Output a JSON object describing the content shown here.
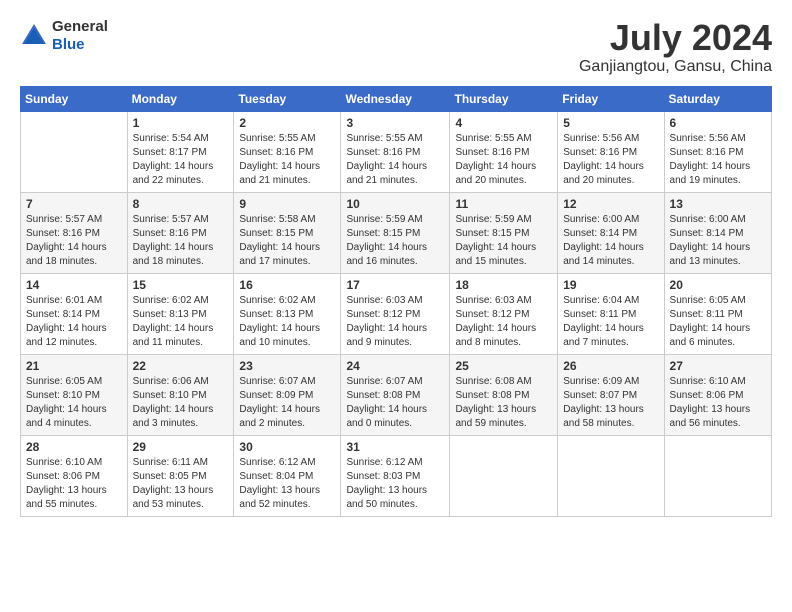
{
  "header": {
    "logo": {
      "line1": "General",
      "line2": "Blue"
    },
    "title": "July 2024",
    "location": "Ganjiangtou, Gansu, China"
  },
  "days_of_week": [
    "Sunday",
    "Monday",
    "Tuesday",
    "Wednesday",
    "Thursday",
    "Friday",
    "Saturday"
  ],
  "weeks": [
    [
      {
        "day": "",
        "info": ""
      },
      {
        "day": "1",
        "info": "Sunrise: 5:54 AM\nSunset: 8:17 PM\nDaylight: 14 hours\nand 22 minutes."
      },
      {
        "day": "2",
        "info": "Sunrise: 5:55 AM\nSunset: 8:16 PM\nDaylight: 14 hours\nand 21 minutes."
      },
      {
        "day": "3",
        "info": "Sunrise: 5:55 AM\nSunset: 8:16 PM\nDaylight: 14 hours\nand 21 minutes."
      },
      {
        "day": "4",
        "info": "Sunrise: 5:55 AM\nSunset: 8:16 PM\nDaylight: 14 hours\nand 20 minutes."
      },
      {
        "day": "5",
        "info": "Sunrise: 5:56 AM\nSunset: 8:16 PM\nDaylight: 14 hours\nand 20 minutes."
      },
      {
        "day": "6",
        "info": "Sunrise: 5:56 AM\nSunset: 8:16 PM\nDaylight: 14 hours\nand 19 minutes."
      }
    ],
    [
      {
        "day": "7",
        "info": "Sunrise: 5:57 AM\nSunset: 8:16 PM\nDaylight: 14 hours\nand 18 minutes."
      },
      {
        "day": "8",
        "info": "Sunrise: 5:57 AM\nSunset: 8:16 PM\nDaylight: 14 hours\nand 18 minutes."
      },
      {
        "day": "9",
        "info": "Sunrise: 5:58 AM\nSunset: 8:15 PM\nDaylight: 14 hours\nand 17 minutes."
      },
      {
        "day": "10",
        "info": "Sunrise: 5:59 AM\nSunset: 8:15 PM\nDaylight: 14 hours\nand 16 minutes."
      },
      {
        "day": "11",
        "info": "Sunrise: 5:59 AM\nSunset: 8:15 PM\nDaylight: 14 hours\nand 15 minutes."
      },
      {
        "day": "12",
        "info": "Sunrise: 6:00 AM\nSunset: 8:14 PM\nDaylight: 14 hours\nand 14 minutes."
      },
      {
        "day": "13",
        "info": "Sunrise: 6:00 AM\nSunset: 8:14 PM\nDaylight: 14 hours\nand 13 minutes."
      }
    ],
    [
      {
        "day": "14",
        "info": "Sunrise: 6:01 AM\nSunset: 8:14 PM\nDaylight: 14 hours\nand 12 minutes."
      },
      {
        "day": "15",
        "info": "Sunrise: 6:02 AM\nSunset: 8:13 PM\nDaylight: 14 hours\nand 11 minutes."
      },
      {
        "day": "16",
        "info": "Sunrise: 6:02 AM\nSunset: 8:13 PM\nDaylight: 14 hours\nand 10 minutes."
      },
      {
        "day": "17",
        "info": "Sunrise: 6:03 AM\nSunset: 8:12 PM\nDaylight: 14 hours\nand 9 minutes."
      },
      {
        "day": "18",
        "info": "Sunrise: 6:03 AM\nSunset: 8:12 PM\nDaylight: 14 hours\nand 8 minutes."
      },
      {
        "day": "19",
        "info": "Sunrise: 6:04 AM\nSunset: 8:11 PM\nDaylight: 14 hours\nand 7 minutes."
      },
      {
        "day": "20",
        "info": "Sunrise: 6:05 AM\nSunset: 8:11 PM\nDaylight: 14 hours\nand 6 minutes."
      }
    ],
    [
      {
        "day": "21",
        "info": "Sunrise: 6:05 AM\nSunset: 8:10 PM\nDaylight: 14 hours\nand 4 minutes."
      },
      {
        "day": "22",
        "info": "Sunrise: 6:06 AM\nSunset: 8:10 PM\nDaylight: 14 hours\nand 3 minutes."
      },
      {
        "day": "23",
        "info": "Sunrise: 6:07 AM\nSunset: 8:09 PM\nDaylight: 14 hours\nand 2 minutes."
      },
      {
        "day": "24",
        "info": "Sunrise: 6:07 AM\nSunset: 8:08 PM\nDaylight: 14 hours\nand 0 minutes."
      },
      {
        "day": "25",
        "info": "Sunrise: 6:08 AM\nSunset: 8:08 PM\nDaylight: 13 hours\nand 59 minutes."
      },
      {
        "day": "26",
        "info": "Sunrise: 6:09 AM\nSunset: 8:07 PM\nDaylight: 13 hours\nand 58 minutes."
      },
      {
        "day": "27",
        "info": "Sunrise: 6:10 AM\nSunset: 8:06 PM\nDaylight: 13 hours\nand 56 minutes."
      }
    ],
    [
      {
        "day": "28",
        "info": "Sunrise: 6:10 AM\nSunset: 8:06 PM\nDaylight: 13 hours\nand 55 minutes."
      },
      {
        "day": "29",
        "info": "Sunrise: 6:11 AM\nSunset: 8:05 PM\nDaylight: 13 hours\nand 53 minutes."
      },
      {
        "day": "30",
        "info": "Sunrise: 6:12 AM\nSunset: 8:04 PM\nDaylight: 13 hours\nand 52 minutes."
      },
      {
        "day": "31",
        "info": "Sunrise: 6:12 AM\nSunset: 8:03 PM\nDaylight: 13 hours\nand 50 minutes."
      },
      {
        "day": "",
        "info": ""
      },
      {
        "day": "",
        "info": ""
      },
      {
        "day": "",
        "info": ""
      }
    ]
  ]
}
